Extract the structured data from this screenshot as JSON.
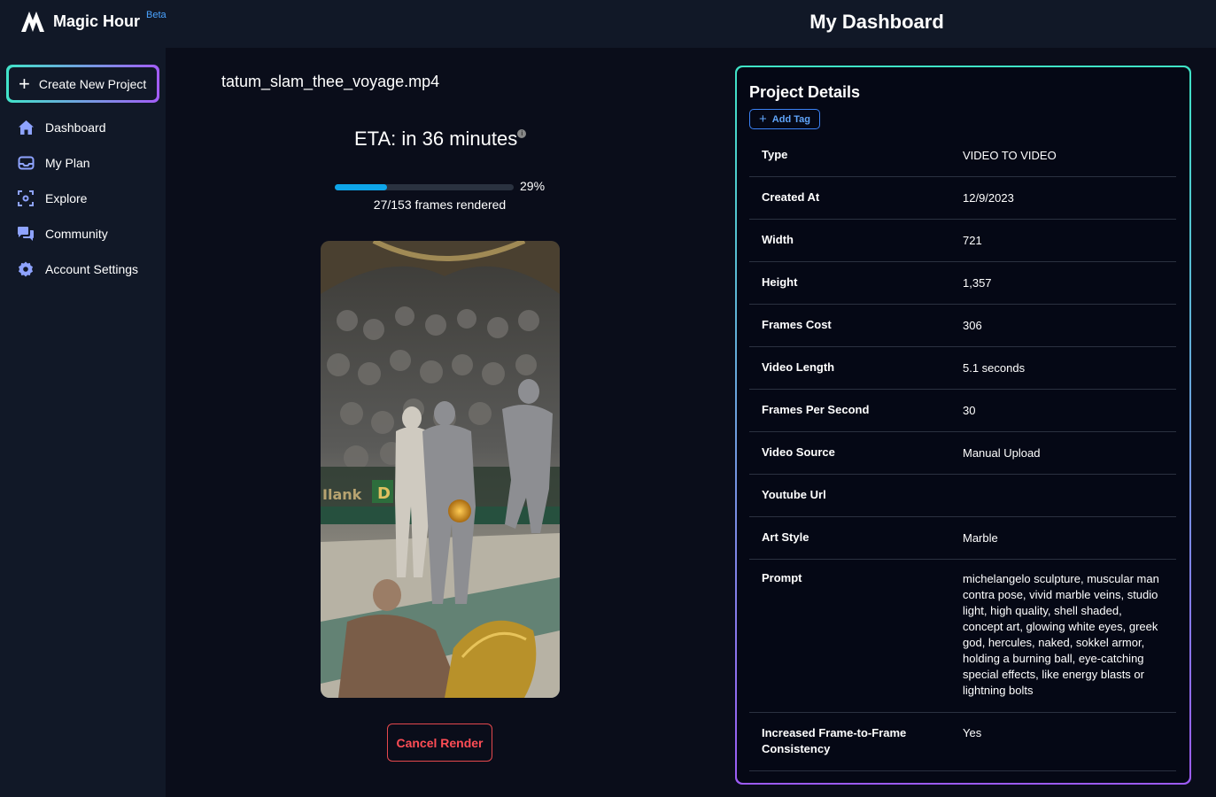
{
  "app": {
    "name": "Magic Hour",
    "badge": "Beta"
  },
  "header": {
    "title": "My Dashboard"
  },
  "sidebar": {
    "create_label": "Create New Project",
    "items": [
      {
        "label": "Dashboard",
        "icon": "home-icon"
      },
      {
        "label": "My Plan",
        "icon": "inbox-icon"
      },
      {
        "label": "Explore",
        "icon": "scan-icon"
      },
      {
        "label": "Community",
        "icon": "chat-icon"
      },
      {
        "label": "Account Settings",
        "icon": "gear-icon"
      }
    ]
  },
  "render": {
    "filename": "tatum_slam_thee_voyage.mp4",
    "eta": "ETA: in 36 minutes",
    "progress_percent": 29,
    "progress_label": "29%",
    "frames_label": "27/153 frames rendered",
    "cancel_label": "Cancel Render"
  },
  "details": {
    "title": "Project Details",
    "add_tag_label": "Add Tag",
    "rows": [
      {
        "key": "Type",
        "value": "VIDEO TO VIDEO"
      },
      {
        "key": "Created At",
        "value": "12/9/2023"
      },
      {
        "key": "Width",
        "value": "721"
      },
      {
        "key": "Height",
        "value": "1,357"
      },
      {
        "key": "Frames Cost",
        "value": "306"
      },
      {
        "key": "Video Length",
        "value": "5.1 seconds"
      },
      {
        "key": "Frames Per Second",
        "value": "30"
      },
      {
        "key": "Video Source",
        "value": "Manual Upload"
      },
      {
        "key": "Youtube Url",
        "value": ""
      },
      {
        "key": "Art Style",
        "value": "Marble"
      },
      {
        "key": "Prompt",
        "value": "michelangelo sculpture, muscular man contra pose, vivid marble veins, studio light, high quality, shell shaded, concept art, glowing white eyes, greek god, hercules, naked, sokkel armor, holding a burning ball, eye-catching special effects, like energy blasts or lightning bolts"
      },
      {
        "key": "Increased Frame-to-Frame Consistency",
        "value": "Yes"
      }
    ]
  },
  "colors": {
    "accent_start": "#3fe3c6",
    "accent_end": "#9c5bf5",
    "progress": "#0ea5e9",
    "danger": "#e5484d"
  }
}
